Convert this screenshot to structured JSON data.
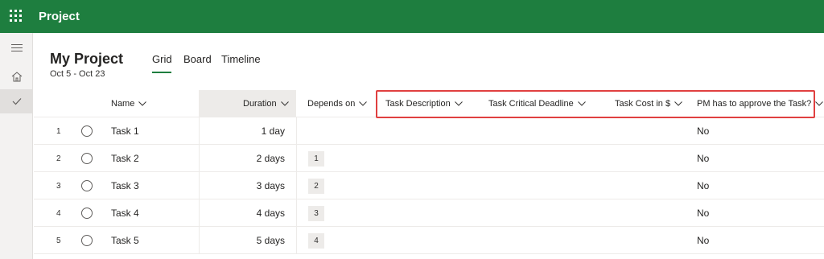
{
  "app": {
    "title": "Project"
  },
  "rail": {
    "items": [
      "hamburger-icon",
      "home-icon",
      "checkmark-icon"
    ]
  },
  "project": {
    "title": "My Project",
    "dates": "Oct 5 - Oct 23"
  },
  "tabs": [
    {
      "label": "Grid",
      "active": true
    },
    {
      "label": "Board",
      "active": false
    },
    {
      "label": "Timeline",
      "active": false
    }
  ],
  "columns": {
    "name": "Name",
    "duration": "Duration",
    "depends_on": "Depends on",
    "task_description": "Task Description",
    "task_critical_deadline": "Task Critical Deadline",
    "task_cost": "Task Cost in $",
    "pm_approve": "PM has to approve the Task?"
  },
  "rows": [
    {
      "num": "1",
      "name": "Task 1",
      "duration": "1 day",
      "depends_on": "",
      "pm_approve": "No"
    },
    {
      "num": "2",
      "name": "Task 2",
      "duration": "2 days",
      "depends_on": "1",
      "pm_approve": "No"
    },
    {
      "num": "3",
      "name": "Task 3",
      "duration": "3 days",
      "depends_on": "2",
      "pm_approve": "No"
    },
    {
      "num": "4",
      "name": "Task 4",
      "duration": "4 days",
      "depends_on": "3",
      "pm_approve": "No"
    },
    {
      "num": "5",
      "name": "Task 5",
      "duration": "5 days",
      "depends_on": "4",
      "pm_approve": "No"
    }
  ],
  "colors": {
    "brand": "#1e7e3f",
    "highlight": "#e04040"
  }
}
